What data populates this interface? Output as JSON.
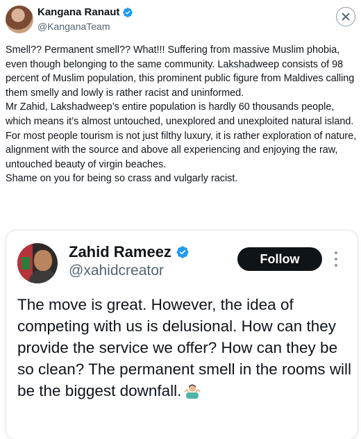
{
  "tweet": {
    "author_name": "Kangana Ranaut",
    "author_handle": "@KanganaTeam",
    "paragraphs": [
      "Smell?? Permanent smell?? What!!! Suffering from massive Muslim phobia, even though belonging to the same community. Lakshadweep consists of 98 percent of Muslim population, this prominent public figure from Maldives calling them smelly and lowly is rather racist and uninformed.",
      "Mr Zahid, Lakshadweep’s entire population is hardly 60 thousands people, which means it’s almost untouched, unexplored and unexploited natural island.",
      "For most people tourism is not just filthy luxury, it is rather exploration of nature, alignment with the source and above all experiencing and enjoying the raw, untouched beauty of virgin beaches.",
      "Shame on you for being so crass and vulgarly racist."
    ]
  },
  "quoted": {
    "author_name": "Zahid Rameez",
    "author_handle": "@xahidcreator",
    "follow_label": "Follow",
    "text": "The move is great. However, the idea of competing with us is delusional. How can they provide the service we offer? How can they be so clean? The permanent smell in the rooms will be the biggest downfall."
  },
  "icons": {
    "verified": "verified-badge-icon",
    "close": "close-icon",
    "more": "more-options-icon",
    "emoji": "person-shrugging-emoji"
  },
  "colors": {
    "verified_blue": "#1d9bf0",
    "text_primary": "#0f1419",
    "text_secondary": "#536471",
    "follow_bg": "#0f1419"
  }
}
